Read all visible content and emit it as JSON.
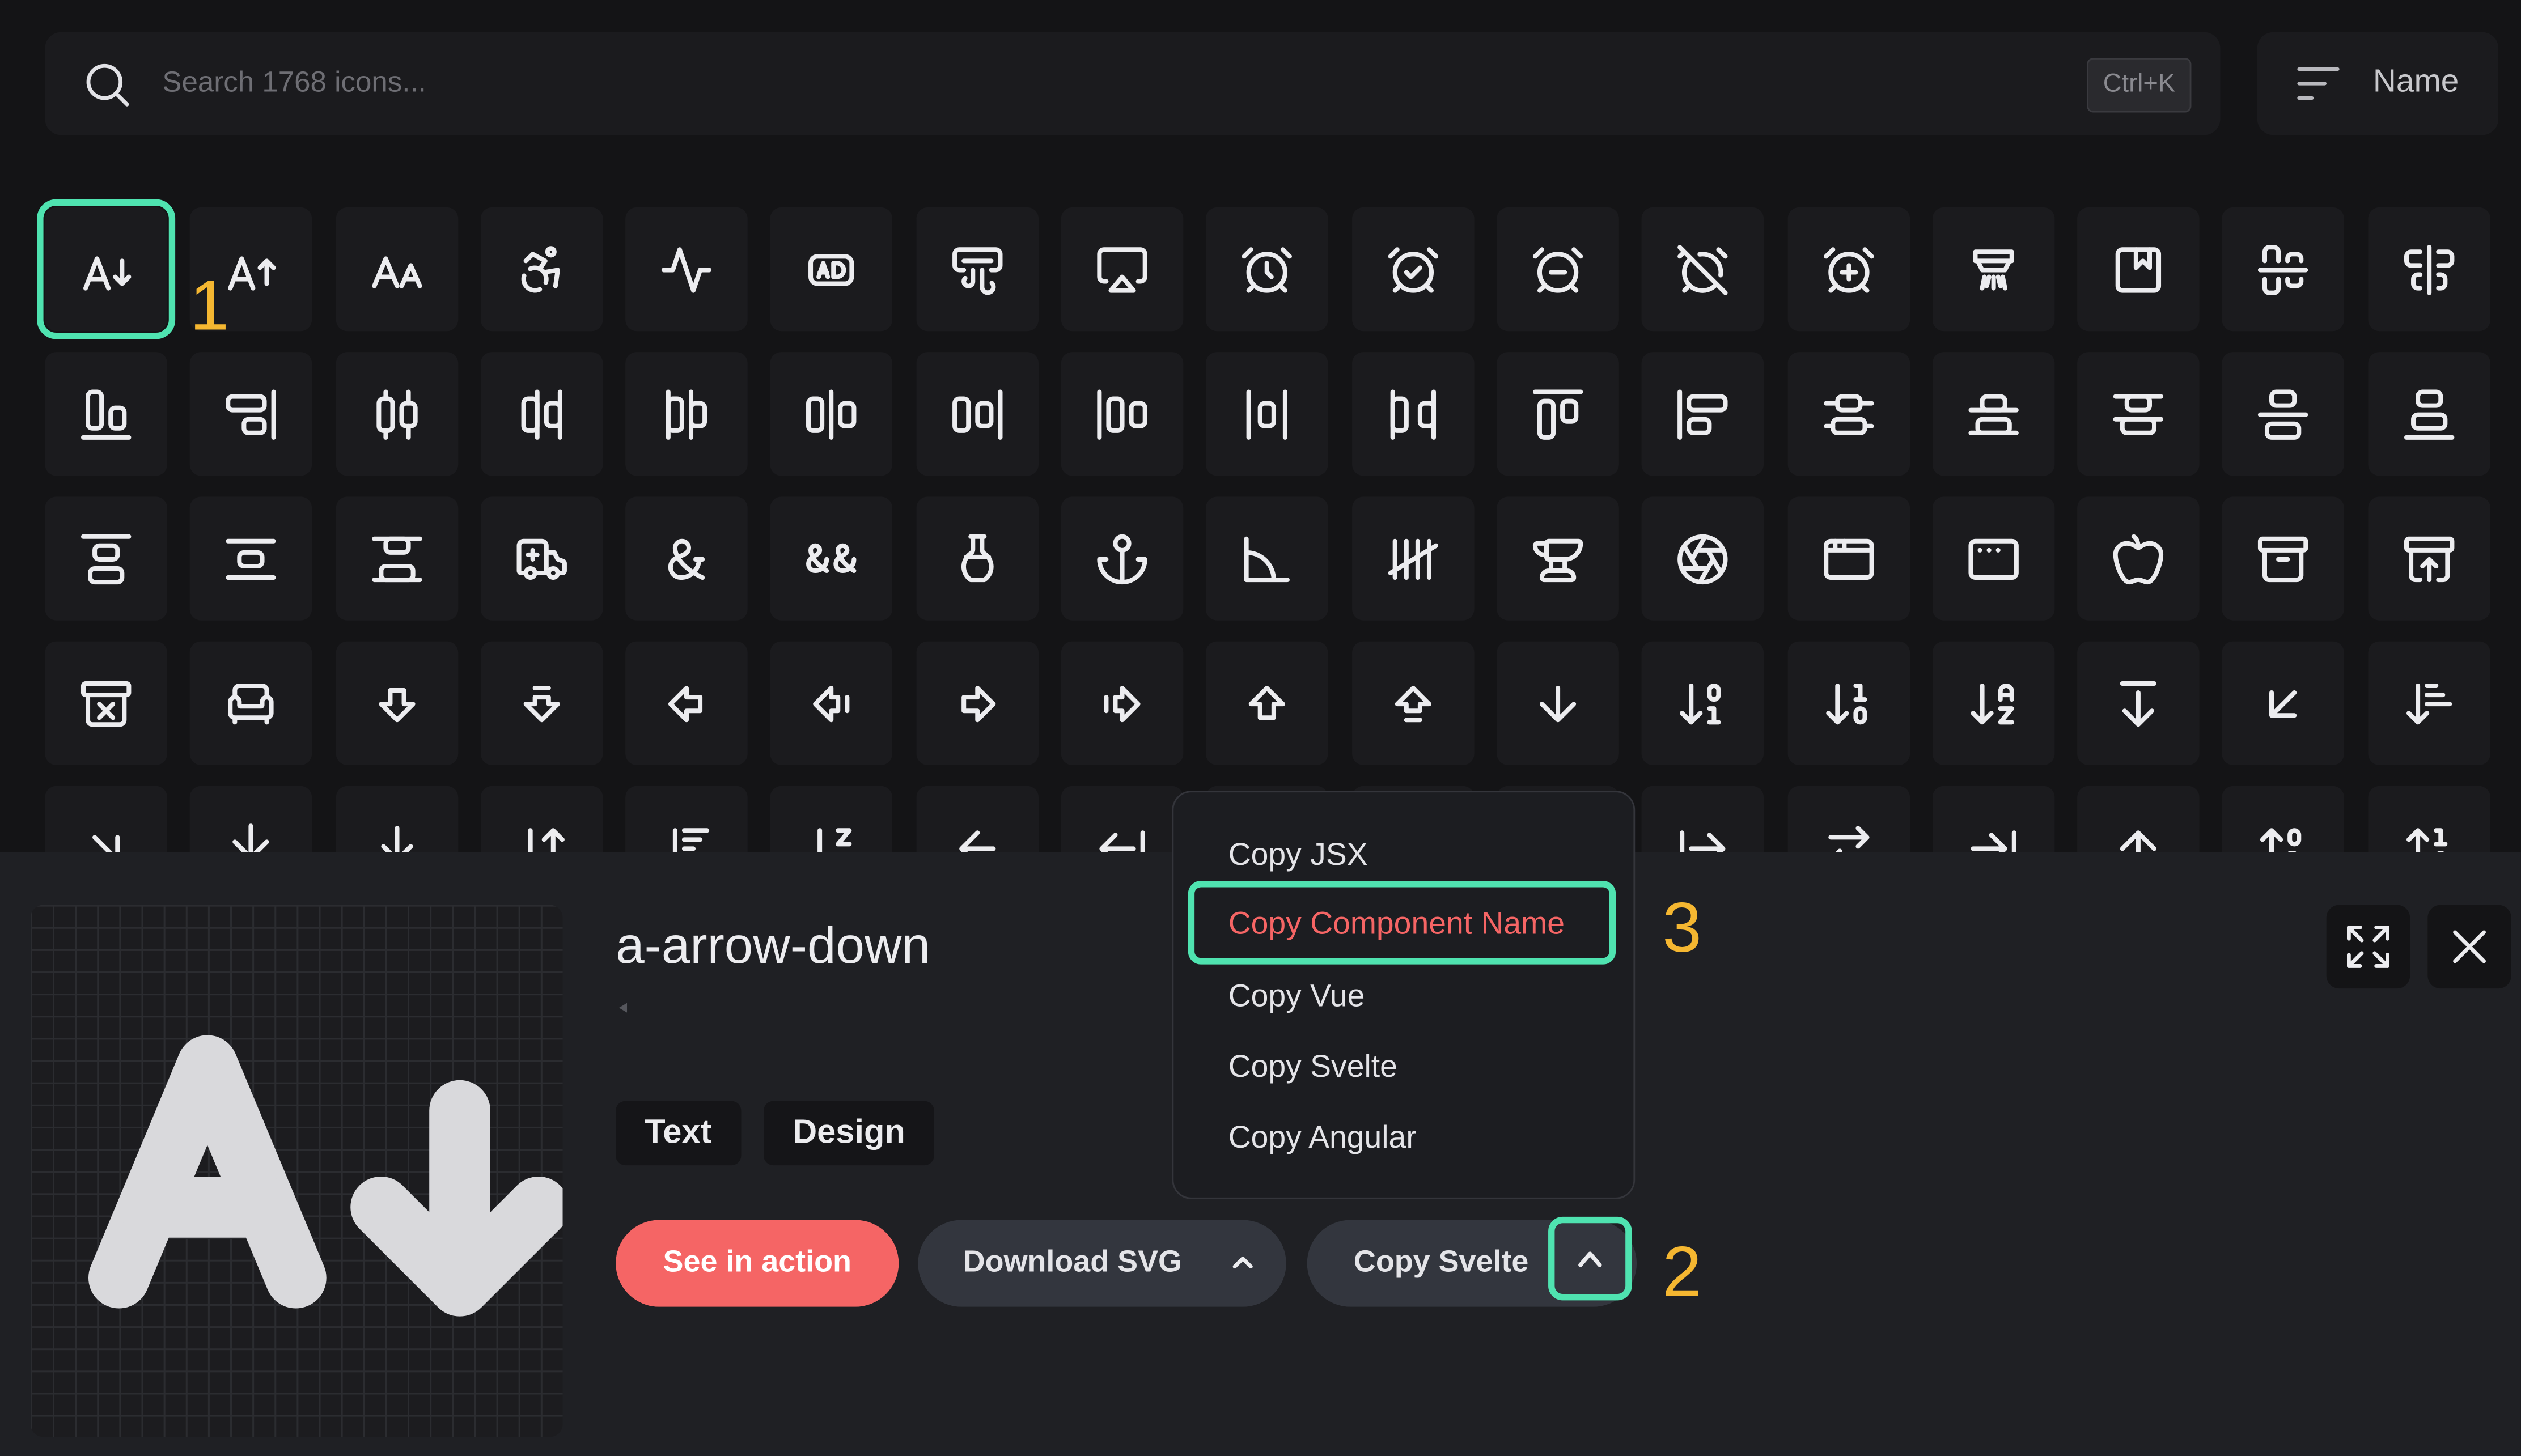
{
  "search": {
    "placeholder": "Search 1768 icons...",
    "shortcut": "Ctrl+K",
    "icon": "search-icon"
  },
  "sort": {
    "label": "Name",
    "icon": "sort-lines-icon"
  },
  "grid": {
    "selected_index": 0,
    "total_icons": 1768
  },
  "detail": {
    "icon_name": "a-arrow-down",
    "tags": [
      "Text",
      "Design"
    ],
    "see_in_action": "See in action",
    "download_svg": "Download SVG",
    "copy_button": "Copy Svelte",
    "fullscreen_icon": "expand-icon",
    "close_icon": "close-icon"
  },
  "dropdown": {
    "items": [
      "Copy JSX",
      "Copy Component Name",
      "Copy Vue",
      "Copy Svelte",
      "Copy Angular"
    ],
    "highlighted": "Copy Component Name"
  },
  "annotations": {
    "step1": "1",
    "step2": "2",
    "step3": "3"
  },
  "colors": {
    "accent": "#4fe3b0",
    "primary": "#f56565",
    "annotation": "#f5b731",
    "background": "#141416"
  }
}
